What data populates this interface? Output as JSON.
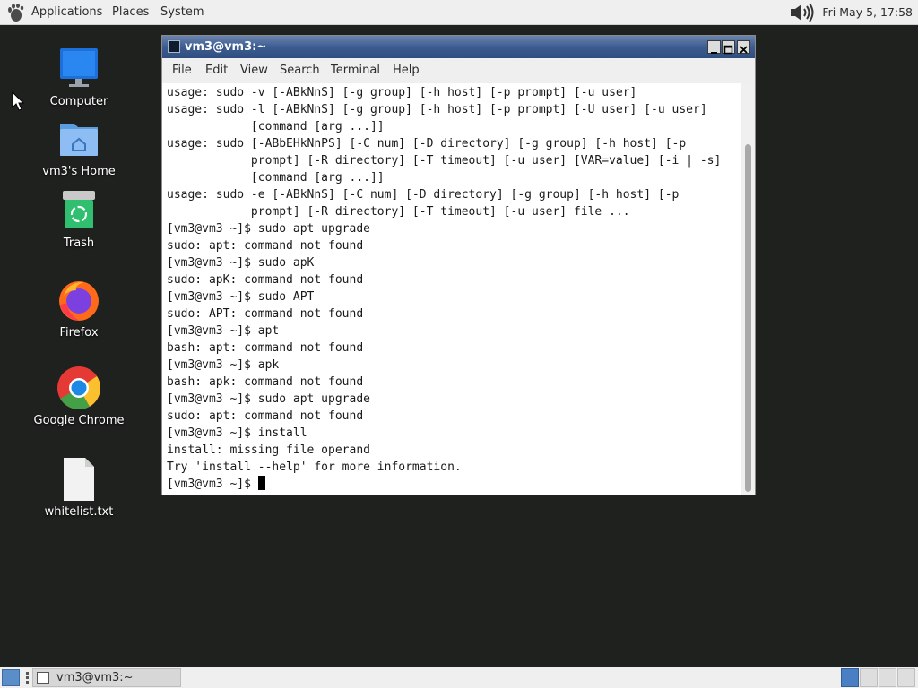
{
  "top_panel": {
    "menus": [
      "Applications",
      "Places",
      "System"
    ],
    "clock": "Fri May  5, 17:58"
  },
  "desktop": {
    "icons": [
      {
        "label": "Computer",
        "icon": "computer-icon"
      },
      {
        "label": "vm3's Home",
        "icon": "home-folder-icon"
      },
      {
        "label": "Trash",
        "icon": "trash-icon"
      },
      {
        "label": "Firefox",
        "icon": "firefox-icon"
      },
      {
        "label": "Google Chrome",
        "icon": "chrome-icon"
      },
      {
        "label": "whitelist.txt",
        "icon": "text-file-icon"
      }
    ]
  },
  "terminal": {
    "title": "vm3@vm3:~",
    "menus": [
      "File",
      "Edit",
      "View",
      "Search",
      "Terminal",
      "Help"
    ],
    "lines": [
      "usage: sudo -v [-ABkNnS] [-g group] [-h host] [-p prompt] [-u user]",
      "usage: sudo -l [-ABkNnS] [-g group] [-h host] [-p prompt] [-U user] [-u user]",
      "            [command [arg ...]]",
      "usage: sudo [-ABbEHkNnPS] [-C num] [-D directory] [-g group] [-h host] [-p",
      "            prompt] [-R directory] [-T timeout] [-u user] [VAR=value] [-i | -s]",
      "            [command [arg ...]]",
      "usage: sudo -e [-ABkNnS] [-C num] [-D directory] [-g group] [-h host] [-p",
      "            prompt] [-R directory] [-T timeout] [-u user] file ...",
      "[vm3@vm3 ~]$ sudo apt upgrade",
      "sudo: apt: command not found",
      "[vm3@vm3 ~]$ sudo apK",
      "sudo: apK: command not found",
      "[vm3@vm3 ~]$ sudo APT",
      "sudo: APT: command not found",
      "[vm3@vm3 ~]$ apt",
      "bash: apt: command not found",
      "[vm3@vm3 ~]$ apk",
      "bash: apk: command not found",
      "[vm3@vm3 ~]$ sudo apt upgrade",
      "sudo: apt: command not found",
      "[vm3@vm3 ~]$ install",
      "install: missing file operand",
      "Try 'install --help' for more information."
    ],
    "prompt": "[vm3@vm3 ~]$ "
  },
  "taskbar": {
    "task_label": "vm3@vm3:~"
  },
  "colors": {
    "desktop_bg": "#1f211f",
    "titlebar": "#3c5c91",
    "workspace_active": "#4a7fc4"
  }
}
